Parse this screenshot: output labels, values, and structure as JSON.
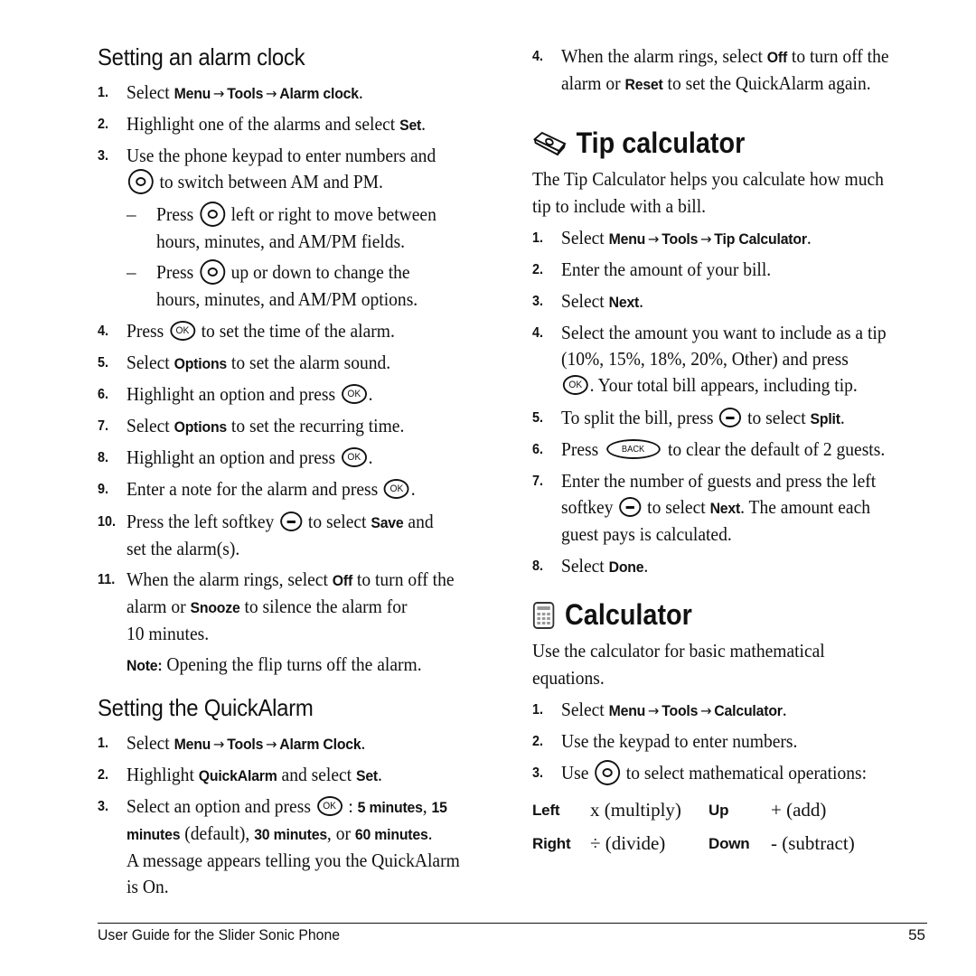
{
  "left": {
    "alarm_heading": "Setting an alarm clock",
    "alarm_steps": {
      "s1": {
        "num": "1.",
        "pre": "Select ",
        "m1": "Menu",
        "m2": "Tools",
        "m3": "Alarm clock",
        "post": "."
      },
      "s2": {
        "num": "2.",
        "pre": "Highlight one of the alarms and select ",
        "b": "Set",
        "post": "."
      },
      "s3": {
        "num": "3.",
        "line1": "Use the phone keypad to enter numbers and",
        "line2": " to switch between AM and PM."
      },
      "s3a": {
        "dash": "–",
        "pre": "Press ",
        "post": " left or right to move between",
        "line2": "hours, minutes, and AM/PM fields."
      },
      "s3b": {
        "dash": "–",
        "pre": "Press ",
        "post": " up or down to change the",
        "line2": "hours, minutes, and AM/PM options."
      },
      "s4": {
        "num": "4.",
        "pre": "Press ",
        "post": " to set the time of the alarm."
      },
      "s5": {
        "num": "5.",
        "pre": "Select ",
        "b": "Options",
        "post": " to set the alarm sound."
      },
      "s6": {
        "num": "6.",
        "pre": "Highlight an option and press ",
        "post": "."
      },
      "s7": {
        "num": "7.",
        "pre": "Select ",
        "b": "Options",
        "post": " to set the recurring time."
      },
      "s8": {
        "num": "8.",
        "pre": "Highlight an option and press ",
        "post": "."
      },
      "s9": {
        "num": "9.",
        "pre": "Enter a note for the alarm and press ",
        "post": "."
      },
      "s10": {
        "num": "10.",
        "pre": "Press the left softkey ",
        "mid": " to select ",
        "b": "Save",
        "post": " and",
        "line2": "set the alarm(s)."
      },
      "s11": {
        "num": "11.",
        "pre": "When the alarm rings, select ",
        "b1": "Off",
        "mid": " to turn off the",
        "l2pre": "alarm or ",
        "b2": "Snooze",
        "l2post": " to silence the alarm for",
        "line3": "10 minutes."
      }
    },
    "note": {
      "label": "Note:",
      "text": "  Opening the flip turns off the alarm."
    },
    "quick_heading": "Setting the QuickAlarm",
    "quick_steps": {
      "s1": {
        "num": "1.",
        "pre": "Select ",
        "m1": "Menu",
        "m2": "Tools",
        "m3": "Alarm Clock",
        "post": "."
      },
      "s2": {
        "num": "2.",
        "pre": "Highlight ",
        "b1": "QuickAlarm",
        "mid": " and select ",
        "b2": "Set",
        "post": "."
      },
      "s3": {
        "num": "3.",
        "pre": "Select an option and press ",
        "colon": " : ",
        "b1": "5 minutes",
        "c1": ", ",
        "b2a": "15",
        "b2b": "minutes",
        "d": " (default), ",
        "b3": "30 minutes",
        "c3": ", or ",
        "b4": "60 minutes",
        "p": ".",
        "line3": "A message appears telling you the QuickAlarm",
        "line4": "is On."
      }
    }
  },
  "right": {
    "q4": {
      "num": "4.",
      "pre": "When the alarm rings, select ",
      "b1": "Off",
      "mid": " to turn off the",
      "l2pre": "alarm or ",
      "b2": "Reset",
      "l2post": " to set the QuickAlarm again."
    },
    "tip_heading": "Tip calculator",
    "tip_intro_1": "The Tip Calculator helps you calculate how much",
    "tip_intro_2": "tip to include with a bill.",
    "tip_steps": {
      "s1": {
        "num": "1.",
        "pre": "Select ",
        "m1": "Menu",
        "m2": "Tools",
        "m3": "Tip Calculator",
        "post": "."
      },
      "s2": {
        "num": "2.",
        "text": "Enter the amount of your bill."
      },
      "s3": {
        "num": "3.",
        "pre": "Select ",
        "b": "Next",
        "post": "."
      },
      "s4": {
        "num": "4.",
        "line1": "Select the amount you want to include as a tip",
        "line2": "(10%, 15%, 18%, 20%, Other) and press",
        "line3": ". Your total bill appears, including tip."
      },
      "s5": {
        "num": "5.",
        "pre": "To split the bill, press ",
        "mid": " to select ",
        "b": "Split",
        "post": "."
      },
      "s6": {
        "num": "6.",
        "pre": "Press ",
        "key": "BACK",
        "post": " to clear the default of 2 guests."
      },
      "s7": {
        "num": "7.",
        "line1": "Enter the number of guests and press the left",
        "l2pre": "softkey ",
        "l2mid": " to select ",
        "b": "Next",
        "l2post": ". The amount each",
        "line3": "guest pays is calculated."
      },
      "s8": {
        "num": "8.",
        "pre": "Select ",
        "b": "Done",
        "post": "."
      }
    },
    "calc_heading": "Calculator",
    "calc_intro_1": "Use the calculator for basic mathematical",
    "calc_intro_2": "equations.",
    "calc_steps": {
      "s1": {
        "num": "1.",
        "pre": "Select ",
        "m1": "Menu",
        "m2": "Tools",
        "m3": "Calculator",
        "post": "."
      },
      "s2": {
        "num": "2.",
        "text": "Use the keypad to enter numbers."
      },
      "s3": {
        "num": "3.",
        "pre": "Use ",
        "post": " to select mathematical operations:"
      }
    },
    "operations": [
      {
        "dir1": "Left",
        "op1": "x (multiply)",
        "dir2": "Up",
        "op2": "+ (add)"
      },
      {
        "dir1": "Right",
        "op1": "÷ (divide)",
        "dir2": "Down",
        "op2": "- (subtract)"
      }
    ]
  },
  "footer": {
    "title": "User Guide for the Slider Sonic Phone",
    "page": "55"
  },
  "arrow": "→",
  "ok_label": "OK"
}
